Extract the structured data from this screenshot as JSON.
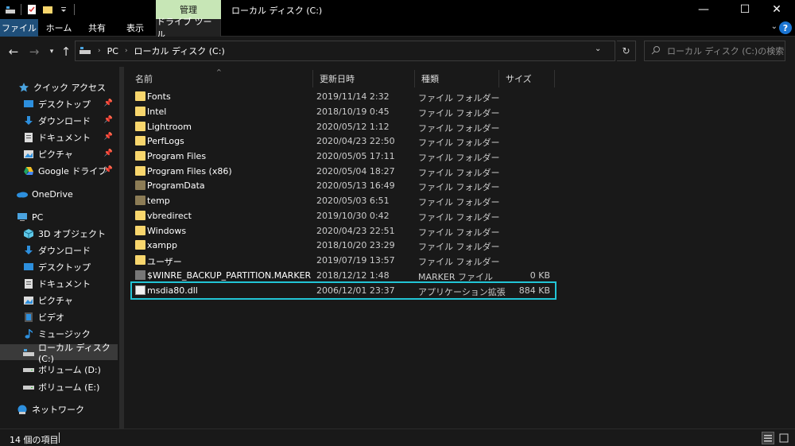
{
  "window": {
    "title": "ローカル ディスク (C:)",
    "manage_tab": "管理",
    "minimize": "—",
    "maximize": "☐",
    "close": "✕"
  },
  "ribbon": {
    "tabs": [
      "ファイル",
      "ホーム",
      "共有",
      "表示",
      "ドライブ ツール"
    ],
    "help": "?"
  },
  "address": {
    "crumbs": [
      "PC",
      "ローカル ディスク (C:)"
    ],
    "search_placeholder": "ローカル ディスク (C:)の検索"
  },
  "sidebar": {
    "quick_access": "クイック アクセス",
    "quick_items": [
      "デスクトップ",
      "ダウンロード",
      "ドキュメント",
      "ピクチャ",
      "Google ドライブ"
    ],
    "onedrive": "OneDrive",
    "pc": "PC",
    "pc_items": [
      "3D オブジェクト",
      "ダウンロード",
      "デスクトップ",
      "ドキュメント",
      "ピクチャ",
      "ビデオ",
      "ミュージック",
      "ローカル ディスク (C:)",
      "ボリューム (D:)",
      "ボリューム (E:)"
    ],
    "network": "ネットワーク"
  },
  "columns": {
    "name": "名前",
    "date": "更新日時",
    "type": "種類",
    "size": "サイズ"
  },
  "files": [
    {
      "name": "Fonts",
      "date": "2019/11/14 2:32",
      "type": "ファイル フォルダー",
      "size": ""
    },
    {
      "name": "Intel",
      "date": "2018/10/19 0:45",
      "type": "ファイル フォルダー",
      "size": ""
    },
    {
      "name": "Lightroom",
      "date": "2020/05/12 1:12",
      "type": "ファイル フォルダー",
      "size": ""
    },
    {
      "name": "PerfLogs",
      "date": "2020/04/23 22:50",
      "type": "ファイル フォルダー",
      "size": ""
    },
    {
      "name": "Program Files",
      "date": "2020/05/05 17:11",
      "type": "ファイル フォルダー",
      "size": ""
    },
    {
      "name": "Program Files (x86)",
      "date": "2020/05/04 18:27",
      "type": "ファイル フォルダー",
      "size": ""
    },
    {
      "name": "ProgramData",
      "date": "2020/05/13 16:49",
      "type": "ファイル フォルダー",
      "size": ""
    },
    {
      "name": "temp",
      "date": "2020/05/03 6:51",
      "type": "ファイル フォルダー",
      "size": ""
    },
    {
      "name": "vbredirect",
      "date": "2019/10/30 0:42",
      "type": "ファイル フォルダー",
      "size": ""
    },
    {
      "name": "Windows",
      "date": "2020/04/23 22:51",
      "type": "ファイル フォルダー",
      "size": ""
    },
    {
      "name": "xampp",
      "date": "2018/10/20 23:29",
      "type": "ファイル フォルダー",
      "size": ""
    },
    {
      "name": "ユーザー",
      "date": "2019/07/19 13:57",
      "type": "ファイル フォルダー",
      "size": ""
    },
    {
      "name": "$WINRE_BACKUP_PARTITION.MARKER",
      "date": "2018/12/12 1:48",
      "type": "MARKER ファイル",
      "size": "0 KB"
    },
    {
      "name": "msdia80.dll",
      "date": "2006/12/01 23:37",
      "type": "アプリケーション拡張",
      "size": "884 KB"
    }
  ],
  "status": {
    "count": "14 個の項目"
  },
  "colors": {
    "accent_selection": "#22c5d6",
    "manage_tab": "#c7e6b6",
    "active_tab": "#1f4f7a",
    "folder": "#f8d66d"
  }
}
